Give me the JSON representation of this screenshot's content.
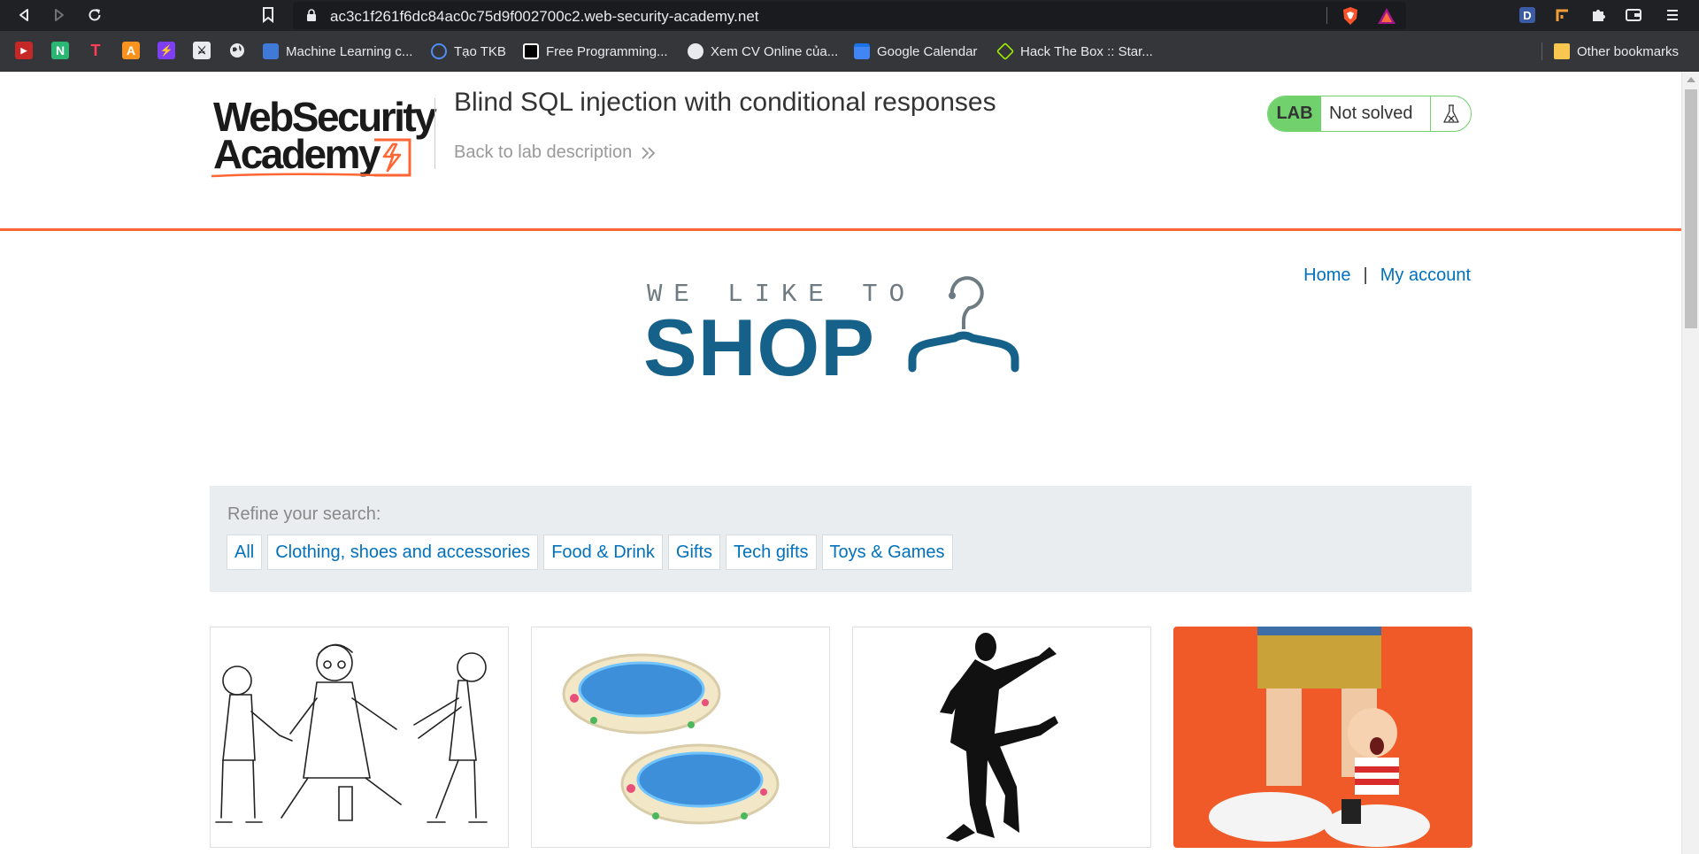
{
  "browser": {
    "url": "ac3c1f261f6dc84ac0c75d9f002700c2.web-security-academy.net",
    "bookmarks": [
      {
        "label": "Machine Learning c...",
        "icon": "ml-icon"
      },
      {
        "label": "Tạo TKB",
        "icon": "tkb-icon"
      },
      {
        "label": "Free Programming...",
        "icon": "programming-icon"
      },
      {
        "label": "Xem CV Online của...",
        "icon": "globe-icon"
      },
      {
        "label": "Google Calendar",
        "icon": "calendar-icon"
      },
      {
        "label": "Hack The Box :: Star...",
        "icon": "hackthebox-icon"
      }
    ],
    "other_bookmarks": "Other bookmarks",
    "quick_icons": [
      "N",
      "T",
      "A"
    ]
  },
  "header": {
    "logo_line1": "WebSecurity",
    "logo_line2": "Academy",
    "lab_title": "Blind SQL injection with conditional responses",
    "back_link": "Back to lab description",
    "lab_badge": "LAB",
    "lab_status": "Not solved",
    "colors": {
      "accent": "#ff6633",
      "status_green": "#70d16d",
      "link": "#0071bc",
      "shop_blue": "#16618a"
    }
  },
  "nav": {
    "home": "Home",
    "separator": "|",
    "account": "My account"
  },
  "banner": {
    "tagline": "WE LIKE TO",
    "title": "SHOP"
  },
  "filters": {
    "label": "Refine your search:",
    "options": [
      "All",
      "Clothing, shoes and accessories",
      "Food & Drink",
      "Gifts",
      "Tech gifts",
      "Toys & Games"
    ]
  },
  "products": [
    {
      "image": "people-tug-of-war-sketch"
    },
    {
      "image": "inflatable-paddling-pools"
    },
    {
      "image": "dancing-man-silhouette"
    },
    {
      "image": "toy-figures-orange-background"
    }
  ]
}
